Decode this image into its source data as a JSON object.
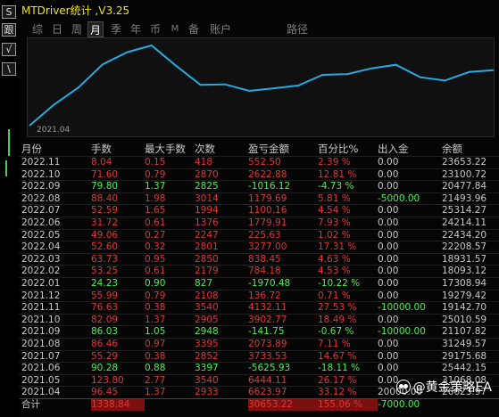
{
  "app": {
    "title": "MTDriver统计 ,V3.25"
  },
  "left_strip": {
    "buttons": [
      "S",
      "跟",
      "√",
      "\\"
    ]
  },
  "tabs": [
    {
      "label": "综",
      "active": false
    },
    {
      "label": "日",
      "active": false
    },
    {
      "label": "周",
      "active": false
    },
    {
      "label": "月",
      "active": true
    },
    {
      "label": "季",
      "active": false
    },
    {
      "label": "年",
      "active": false
    },
    {
      "label": "币",
      "active": false
    },
    {
      "label": "M",
      "active": false
    },
    {
      "label": "备",
      "active": false
    },
    {
      "label": "账户",
      "active": false
    },
    {
      "label": "路径",
      "active": false
    }
  ],
  "chart_data": {
    "type": "line",
    "x_start_label": "2021.04",
    "colors": {
      "line": "#29a8e0"
    },
    "values": [
      6623.97,
      13065,
      18300,
      25442,
      29175,
      31249,
      25010,
      19142,
      19279,
      17308,
      18093,
      18931,
      22208,
      22434,
      24214,
      25314,
      21494,
      20477,
      23100,
      23653
    ]
  },
  "table": {
    "headers": [
      "月份",
      "手数",
      "最大手数",
      "次数",
      "盈亏金额",
      "百分比%",
      "出入金",
      "余额"
    ],
    "rows": [
      {
        "cells": [
          "2022.11",
          "8.04",
          "0.15",
          "418",
          "552.50",
          "2.39 %",
          "0.00",
          "23653.22"
        ],
        "tone": "red"
      },
      {
        "cells": [
          "2022.10",
          "71.60",
          "0.79",
          "2870",
          "2622.88",
          "12.81 %",
          "0.00",
          "23100.72"
        ],
        "tone": "red"
      },
      {
        "cells": [
          "2022.09",
          "79.80",
          "1.37",
          "2825",
          "-1016.12",
          "-4.73 %",
          "0.00",
          "20477.84"
        ],
        "tone": "green"
      },
      {
        "cells": [
          "2022.08",
          "88.40",
          "1.98",
          "3014",
          "1179.69",
          "5.81 %",
          "-5000.00",
          "21493.96"
        ],
        "tone": "red",
        "flow_green": true
      },
      {
        "cells": [
          "2022.07",
          "52.59",
          "1.65",
          "1994",
          "1100.16",
          "4.54 %",
          "0.00",
          "25314.27"
        ],
        "tone": "red"
      },
      {
        "cells": [
          "2022.06",
          "31.72",
          "0.61",
          "1376",
          "1779.91",
          "7.93 %",
          "0.00",
          "24214.11"
        ],
        "tone": "red"
      },
      {
        "cells": [
          "2022.05",
          "49.06",
          "0.27",
          "2247",
          "225.63",
          "1.02 %",
          "0.00",
          "22434.20"
        ],
        "tone": "red"
      },
      {
        "cells": [
          "2022.04",
          "52.60",
          "0.32",
          "2801",
          "3277.00",
          "17.31 %",
          "0.00",
          "22208.57"
        ],
        "tone": "red"
      },
      {
        "cells": [
          "2022.03",
          "63.73",
          "0.95",
          "2850",
          "838.45",
          "4.63 %",
          "0.00",
          "18931.57"
        ],
        "tone": "red"
      },
      {
        "cells": [
          "2022.02",
          "53.25",
          "0.61",
          "2179",
          "784.18",
          "4.53 %",
          "0.00",
          "18093.12"
        ],
        "tone": "red"
      },
      {
        "cells": [
          "2022.01",
          "24.23",
          "0.90",
          "827",
          "-1970.48",
          "-10.22 %",
          "0.00",
          "17308.94"
        ],
        "tone": "green"
      },
      {
        "cells": [
          "2021.12",
          "55.99",
          "0.79",
          "2108",
          "136.72",
          "0.71 %",
          "0.00",
          "19279.42"
        ],
        "tone": "red"
      },
      {
        "cells": [
          "2021.11",
          "76.63",
          "0.38",
          "3540",
          "4132.11",
          "27.53 %",
          "-10000.00",
          "19142.70"
        ],
        "tone": "red",
        "flow_green": true
      },
      {
        "cells": [
          "2021.10",
          "82.09",
          "1.37",
          "2905",
          "3902.77",
          "18.49 %",
          "0.00",
          "25010.59"
        ],
        "tone": "red"
      },
      {
        "cells": [
          "2021.09",
          "86.03",
          "1.05",
          "2948",
          "-141.75",
          "-0.67 %",
          "-10000.00",
          "21107.82"
        ],
        "tone": "green",
        "flow_green": true
      },
      {
        "cells": [
          "2021.08",
          "86.46",
          "0.97",
          "3395",
          "2073.89",
          "7.11 %",
          "0.00",
          "31249.57"
        ],
        "tone": "red"
      },
      {
        "cells": [
          "2021.07",
          "55.29",
          "0.38",
          "2852",
          "3733.53",
          "14.67 %",
          "0.00",
          "29175.68"
        ],
        "tone": "red"
      },
      {
        "cells": [
          "2021.06",
          "90.28",
          "0.88",
          "3397",
          "-5625.93",
          "-18.11 %",
          "0.00",
          "25442.15"
        ],
        "tone": "green"
      },
      {
        "cells": [
          "2021.05",
          "123.80",
          "2.77",
          "3540",
          "6444.11",
          "26.17 %",
          "0.00",
          "31068.08"
        ],
        "tone": "red"
      },
      {
        "cells": [
          "2021.04",
          "96.45",
          "1.37",
          "2933",
          "6623.97",
          "33.12 %",
          "20000.00",
          "26623.97"
        ],
        "tone": "red"
      }
    ],
    "total": {
      "cells": [
        "合计",
        "1338.84",
        "",
        "",
        "30653.22",
        "155.06 %",
        "-7000.00",
        ""
      ]
    }
  },
  "watermark": {
    "text": "@黄金策略EA"
  }
}
